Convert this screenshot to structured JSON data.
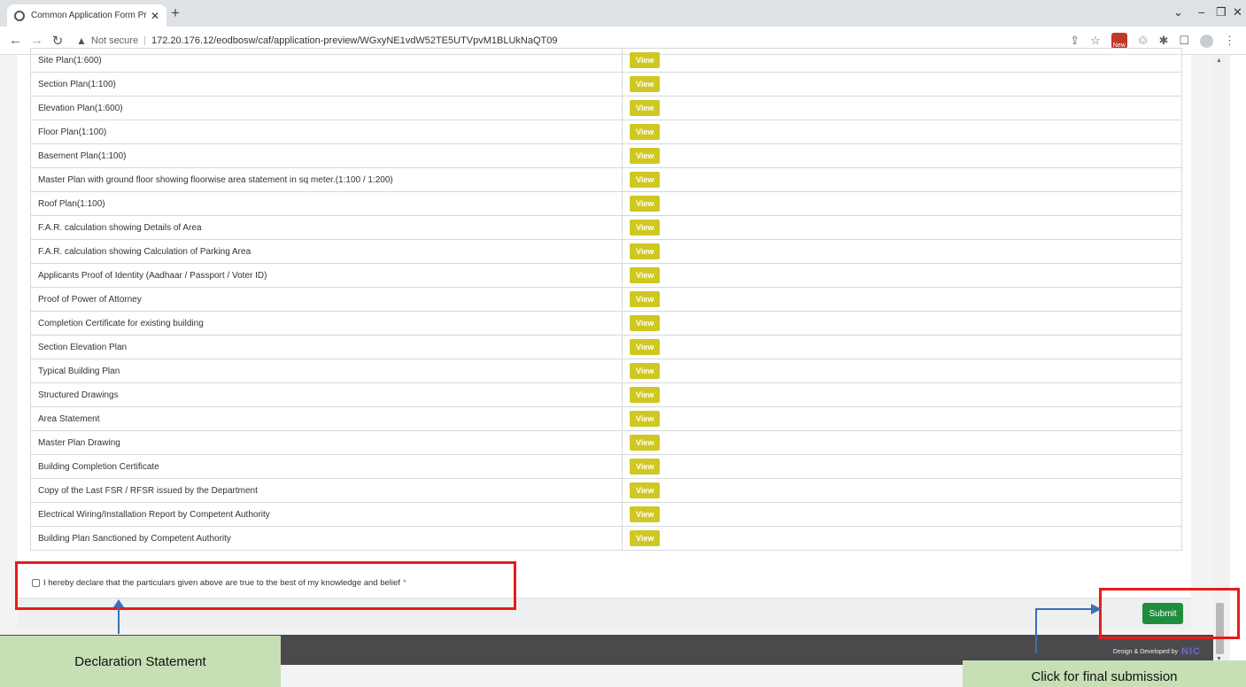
{
  "browser": {
    "tab_title": "Common Application Form Prev",
    "new_tab": "+",
    "security_label": "Not secure",
    "url": "172.20.176.12/eodbosw/caf/application-preview/WGxyNE1vdW52TE5UTVpvM1BLUkNaQT09",
    "ext_new_badge": "New"
  },
  "documents": {
    "view_label": "View",
    "rows": [
      "Site Plan(1:600)",
      "Section Plan(1:100)",
      "Elevation Plan(1:600)",
      "Floor Plan(1:100)",
      "Basement Plan(1:100)",
      "Master Plan with ground floor showing floorwise area statement in sq meter.(1:100 / 1:200)",
      "Roof Plan(1:100)",
      "F.A.R. calculation showing Details of Area",
      "F.A.R. calculation showing Calculation of Parking Area",
      "Applicants Proof of Identity (Aadhaar / Passport / Voter ID)",
      "Proof of Power of Attorney",
      "Completion Certificate for existing building",
      "Section Elevation Plan",
      "Typical Building Plan",
      "Structured Drawings",
      "Area Statement",
      "Master Plan Drawing",
      "Building Completion Certificate",
      "Copy of the Last FSR / RFSR issued by the Department",
      "Electrical Wiring/Installation Report by Competent Authority",
      "Building Plan Sanctioned by Competent Authority"
    ]
  },
  "declaration": {
    "text": "I hereby declare that the particulars given above are true to the best of my knowledge and belief",
    "required_mark": "*"
  },
  "actions": {
    "submit_label": "Submit"
  },
  "footer": {
    "credit": "Design & Developed by",
    "logo_text": "NIC"
  },
  "annotations": {
    "declaration_callout": "Declaration Statement",
    "submit_callout": "Click for final submission",
    "highlight_color": "#e81b1b",
    "callout_color": "#c7dfb5"
  }
}
